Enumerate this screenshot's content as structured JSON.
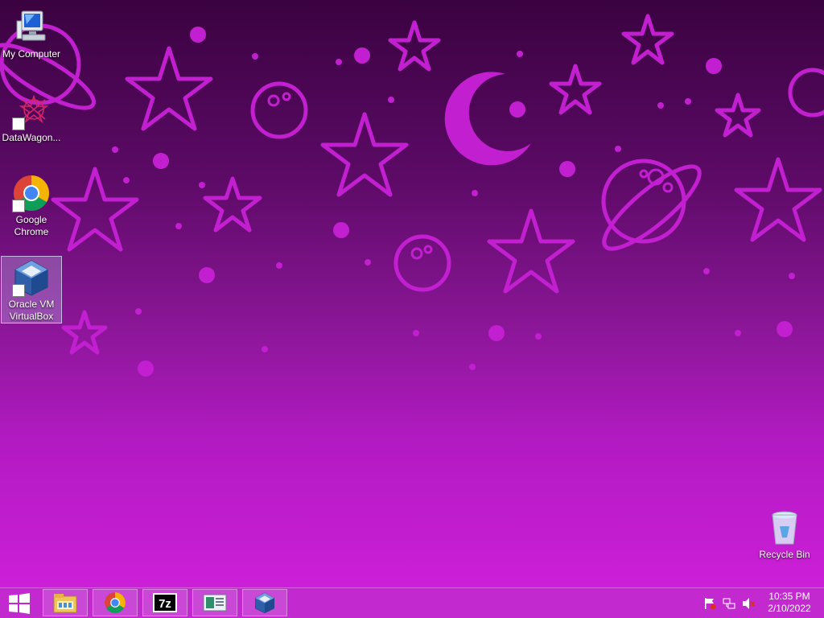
{
  "desktop": {
    "icons": [
      {
        "label": "My Computer"
      },
      {
        "label": "DataWagon..."
      },
      {
        "label": "Google Chrome"
      },
      {
        "label": "Oracle VM VirtualBox"
      },
      {
        "label": "Recycle Bin"
      }
    ]
  },
  "taskbar": {
    "pinned": [
      {
        "icon": "file-explorer-icon"
      },
      {
        "icon": "chrome-icon"
      },
      {
        "icon": "7zip-icon"
      },
      {
        "icon": "control-panel-icon"
      },
      {
        "icon": "virtualbox-icon"
      }
    ],
    "tray": [
      "action-center-flag-icon",
      "network-icon",
      "volume-muted-icon"
    ],
    "clock": {
      "time": "10:35 PM",
      "date": "2/10/2022"
    }
  },
  "colors": {
    "taskbar": "#c22ad0",
    "wallpaper_shapes": "#c21fd0",
    "wallpaper_top": "#3a0240",
    "wallpaper_bottom": "#cc1fd8"
  }
}
